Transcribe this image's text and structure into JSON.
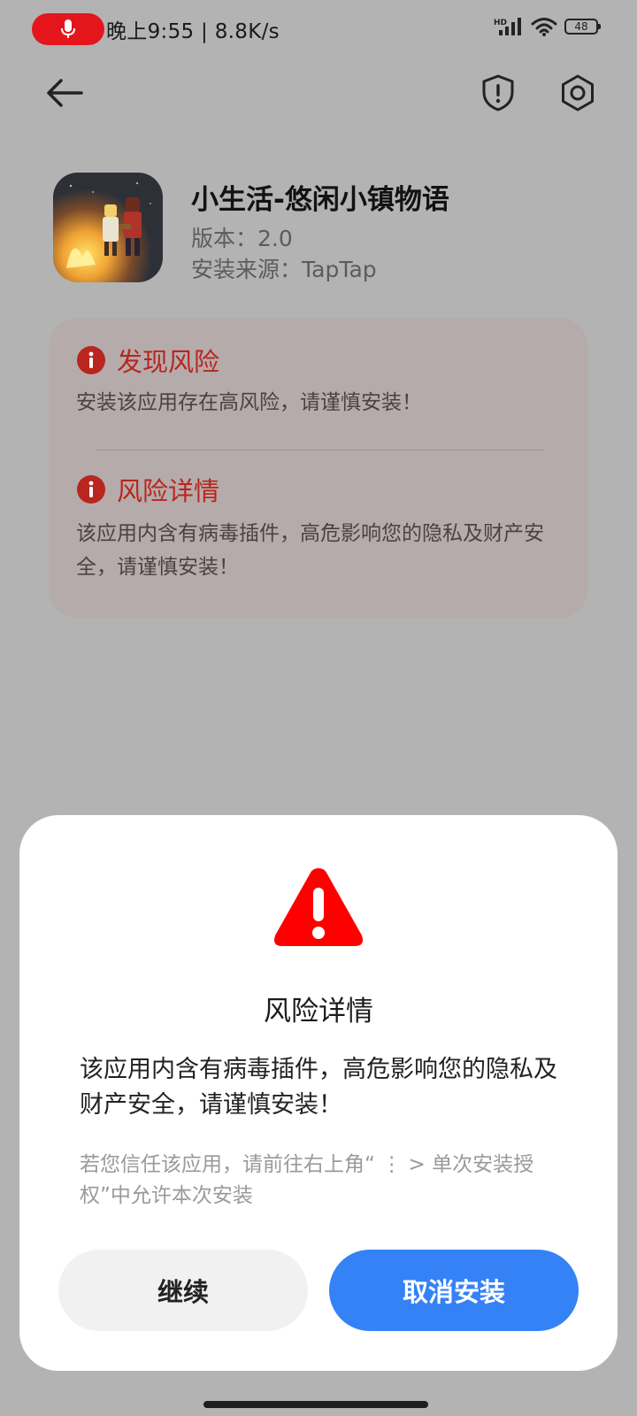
{
  "status_bar": {
    "time": "晚上9:55 | 8.8K/s",
    "network_label": "HD",
    "battery_level": "48",
    "icons": [
      "microphone-icon",
      "signal-icon",
      "wifi-icon",
      "battery-icon"
    ]
  },
  "nav": {
    "icons": [
      "back-arrow-icon",
      "shield-icon",
      "settings-icon"
    ]
  },
  "app": {
    "name": "小生活-悠闲小镇物语",
    "version": "版本：2.0",
    "source": "安装来源：TapTap"
  },
  "risk_card": {
    "found_title": "发现风险",
    "found_text": "安装该应用存在高风险，请谨慎安装！",
    "detail_title": "风险详情",
    "detail_text": "该应用内含有病毒插件，高危影响您的隐私及财产安全，请谨慎安装！"
  },
  "dialog": {
    "title": "风险详情",
    "body": "该应用内含有病毒插件，高危影响您的隐私及财产安全，请谨慎安装！",
    "hint": "若您信任该应用，请前往右上角“ ⋮ > 单次安装授权”中允许本次安装",
    "continue_label": "继续",
    "cancel_label": "取消安装"
  },
  "colors": {
    "background": "#b3b3b3",
    "risk_red": "#b8261f",
    "warning_red": "#ff0000",
    "primary_blue": "#3482f6",
    "mic_red": "#e5151c"
  }
}
